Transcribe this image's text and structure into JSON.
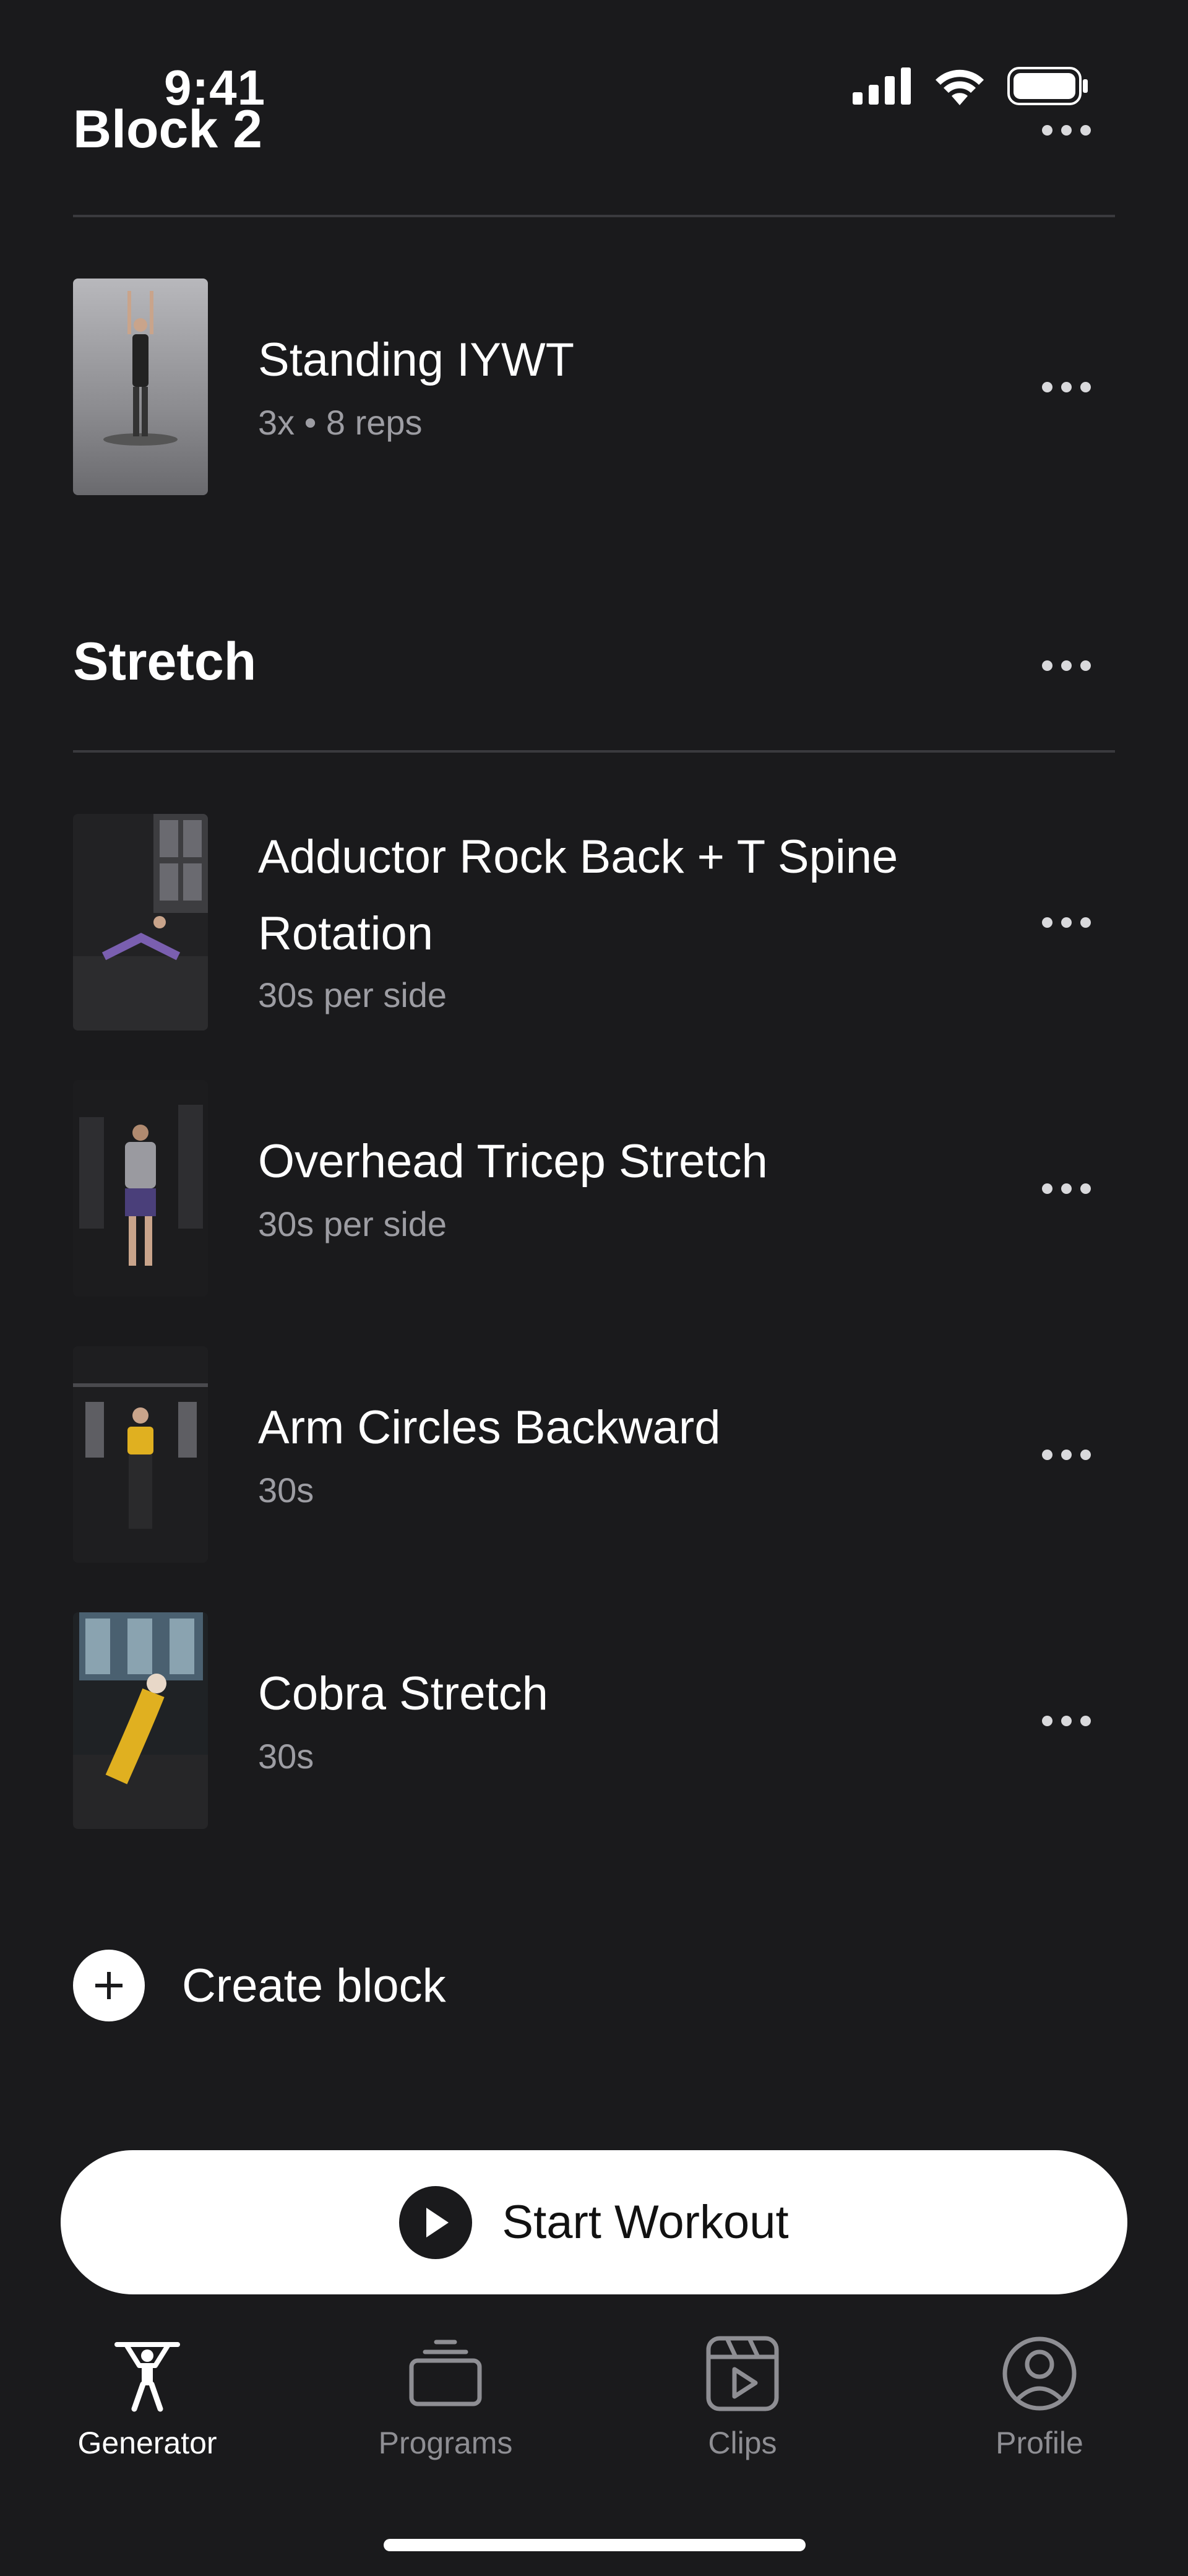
{
  "status_bar": {
    "time": "9:41"
  },
  "header": {
    "block_title": "Block 2"
  },
  "block2": {
    "exercises": [
      {
        "name": "Standing IYWT",
        "meta": "3x • 8 reps"
      }
    ]
  },
  "stretch": {
    "title": "Stretch",
    "exercises": [
      {
        "name": "Adductor Rock Back + T Spine Rotation",
        "meta": "30s per side"
      },
      {
        "name": "Overhead Tricep Stretch",
        "meta": "30s per side"
      },
      {
        "name": "Arm Circles Backward",
        "meta": "30s"
      },
      {
        "name": "Cobra Stretch",
        "meta": "30s"
      }
    ]
  },
  "actions": {
    "create_block": "Create block",
    "start_workout": "Start Workout"
  },
  "tabbar": {
    "items": [
      {
        "label": "Generator",
        "icon": "weightlifter-icon",
        "active": true
      },
      {
        "label": "Programs",
        "icon": "briefcase-icon",
        "active": false
      },
      {
        "label": "Clips",
        "icon": "clips-play-icon",
        "active": false
      },
      {
        "label": "Profile",
        "icon": "profile-icon",
        "active": false
      }
    ]
  },
  "colors": {
    "background": "#1a1a1c",
    "text_primary": "#ffffff",
    "text_secondary": "#9d9da3",
    "tab_inactive": "#8e8e93",
    "divider": "#3a3a3e"
  }
}
